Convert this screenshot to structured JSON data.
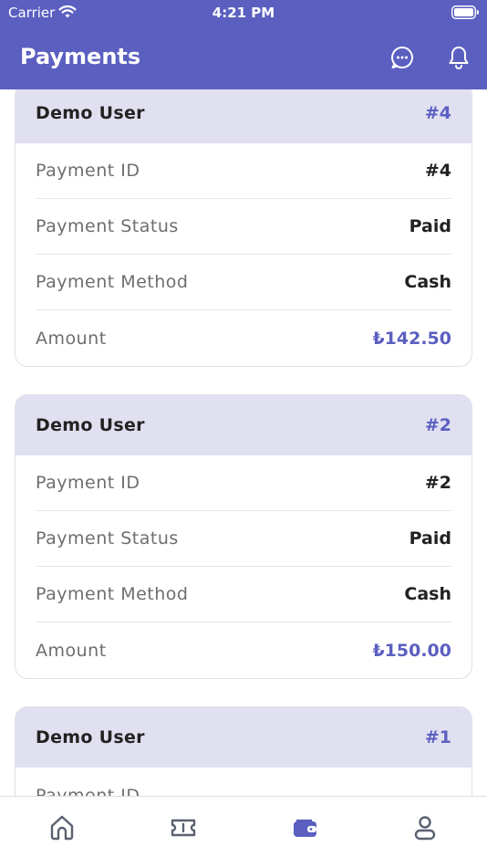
{
  "status_bar": {
    "carrier": "Carrier",
    "time": "4:21 PM"
  },
  "header": {
    "title": "Payments"
  },
  "labels": {
    "payment_id": "Payment ID",
    "payment_status": "Payment Status",
    "payment_method": "Payment Method",
    "amount": "Amount"
  },
  "payments": [
    {
      "user": "Demo User",
      "number": "#4",
      "payment_id": "#4",
      "status": "Paid",
      "method": "Cash",
      "amount": "₺142.50"
    },
    {
      "user": "Demo User",
      "number": "#2",
      "payment_id": "#2",
      "status": "Paid",
      "method": "Cash",
      "amount": "₺150.00"
    },
    {
      "user": "Demo User",
      "number": "#1"
    }
  ],
  "tabs": [
    {
      "icon": "home-icon"
    },
    {
      "icon": "ticket-icon"
    },
    {
      "icon": "wallet-icon",
      "active": true
    },
    {
      "icon": "user-icon"
    }
  ],
  "colors": {
    "accent": "#5b5fc0",
    "card_header": "#e0e0f1",
    "tab_inactive": "#5a6170"
  }
}
